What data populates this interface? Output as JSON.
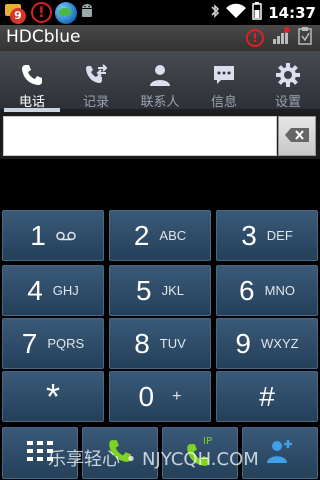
{
  "status_bar": {
    "notification_count": "9",
    "alert_glyph": "!",
    "time": "14:37",
    "icons": [
      "notification-badge-icon",
      "alert-icon",
      "globe-icon",
      "android-icon",
      "bluetooth-icon",
      "wifi-icon",
      "battery-icon"
    ]
  },
  "title_bar": {
    "app_title": "HDCblue",
    "alert_glyph": "!",
    "icons": [
      "alert-icon",
      "signal-icon",
      "clipboard-icon"
    ]
  },
  "tabs": [
    {
      "label": "电话",
      "icon": "phone-icon",
      "active": true
    },
    {
      "label": "记录",
      "icon": "call-log-icon",
      "active": false
    },
    {
      "label": "联系人",
      "icon": "contact-icon",
      "active": false
    },
    {
      "label": "信息",
      "icon": "message-icon",
      "active": false
    },
    {
      "label": "设置",
      "icon": "gear-icon",
      "active": false
    }
  ],
  "number_display": {
    "value": "",
    "backspace_icon": "backspace-icon"
  },
  "keypad": [
    {
      "digit": "1",
      "letters": "",
      "icon": "voicemail-icon"
    },
    {
      "digit": "2",
      "letters": "ABC"
    },
    {
      "digit": "3",
      "letters": "DEF"
    },
    {
      "digit": "4",
      "letters": "GHJ"
    },
    {
      "digit": "5",
      "letters": "JKL"
    },
    {
      "digit": "6",
      "letters": "MNO"
    },
    {
      "digit": "7",
      "letters": "PQRS"
    },
    {
      "digit": "8",
      "letters": "TUV"
    },
    {
      "digit": "9",
      "letters": "WXYZ"
    },
    {
      "digit": "*",
      "letters": ""
    },
    {
      "digit": "0",
      "letters": "+"
    },
    {
      "digit": "#",
      "letters": ""
    }
  ],
  "bottom_bar": {
    "buttons": [
      {
        "icon": "dialpad-icon"
      },
      {
        "icon": "call-icon"
      },
      {
        "icon": "ip-call-icon",
        "label": "IP"
      },
      {
        "icon": "add-contact-icon"
      }
    ],
    "ip_label": "IP"
  },
  "watermark": "乐享轻心 • NJYCQH.COM",
  "colors": {
    "key_top": "#3a5a78",
    "key_bottom": "#24405a",
    "call_green": "#7ed321",
    "contact_blue": "#3fa0e8",
    "alert_red": "#e02020"
  }
}
